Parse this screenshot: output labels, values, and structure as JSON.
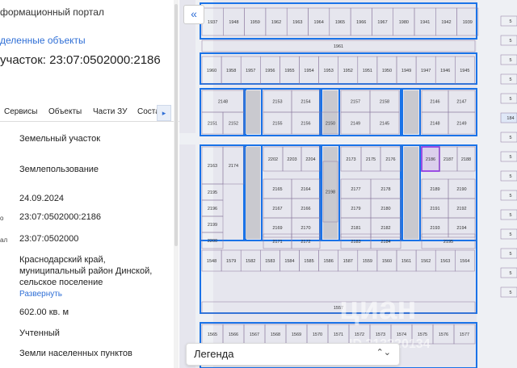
{
  "panel": {
    "portal_title": "формационный портал",
    "selected_link": "деленные объекты",
    "plot_title": "участок: 23:07:0502000:2186",
    "tabs": [
      "Сервисы",
      "Объекты",
      "Части ЗУ",
      "Соста"
    ],
    "tab_more_icon": "chevron-right-icon",
    "rows": [
      {
        "label": "",
        "value": "Земельный участок"
      },
      {
        "label": "",
        "value": "Землепользование"
      },
      {
        "label": "",
        "value": "24.09.2024"
      },
      {
        "label": "о",
        "value": "23:07:0502000:2186"
      },
      {
        "label": "ал",
        "value": "23:07:0502000"
      },
      {
        "label": "",
        "value_lines": [
          "Краснодарский край,",
          "муниципальный район Динской,",
          "сельское поселение"
        ],
        "expand_link": "Развернуть"
      },
      {
        "label": "",
        "value": "602.00 кв. м"
      },
      {
        "label": "",
        "value": "Учтенный"
      },
      {
        "label": "",
        "value": "Земли населенных пунктов"
      }
    ]
  },
  "map": {
    "back_icon": "double-chevron-left-icon",
    "legend_label": "Легенда",
    "legend_arrow_icon": "chevron-updown-icon",
    "watermark": "циан",
    "watermark_id": "ID 313320134",
    "highlight_color": "#8a2be2",
    "boundary_color": "#1a73e8",
    "plots": [
      {
        "n": "1937"
      },
      {
        "n": "1948"
      },
      {
        "n": "1959"
      },
      {
        "n": "1962"
      },
      {
        "n": "1963"
      },
      {
        "n": "1964"
      },
      {
        "n": "1965"
      },
      {
        "n": "1966"
      },
      {
        "n": "1967"
      },
      {
        "n": "1980"
      },
      {
        "n": "1941"
      },
      {
        "n": "1942"
      },
      {
        "n": "1939"
      },
      {
        "n": "1961"
      },
      {
        "n": "1960"
      },
      {
        "n": "1958"
      },
      {
        "n": "1957"
      },
      {
        "n": "1956"
      },
      {
        "n": "1955"
      },
      {
        "n": "1954"
      },
      {
        "n": "1953"
      },
      {
        "n": "1952"
      },
      {
        "n": "1951"
      },
      {
        "n": "1950"
      },
      {
        "n": "1949"
      },
      {
        "n": "1947"
      },
      {
        "n": "1946"
      },
      {
        "n": "1945"
      },
      {
        "n": "2148"
      },
      {
        "n": "2153"
      },
      {
        "n": "2154"
      },
      {
        "n": "2157"
      },
      {
        "n": "2158"
      },
      {
        "n": "2146"
      },
      {
        "n": "2147"
      },
      {
        "n": "2151"
      },
      {
        "n": "2152"
      },
      {
        "n": "2155"
      },
      {
        "n": "2156"
      },
      {
        "n": "2150"
      },
      {
        "n": "2149"
      },
      {
        "n": "2145"
      },
      {
        "n": "2148"
      },
      {
        "n": "2149"
      },
      {
        "n": "2163"
      },
      {
        "n": "2174"
      },
      {
        "n": "2202"
      },
      {
        "n": "2203"
      },
      {
        "n": "2204"
      },
      {
        "n": "2173"
      },
      {
        "n": "2175"
      },
      {
        "n": "2176"
      },
      {
        "n": "2186",
        "highlight": true
      },
      {
        "n": "2187"
      },
      {
        "n": "2188"
      },
      {
        "n": "2195"
      },
      {
        "n": "2165"
      },
      {
        "n": "2164"
      },
      {
        "n": "2198"
      },
      {
        "n": "2177"
      },
      {
        "n": "2178"
      },
      {
        "n": "2189"
      },
      {
        "n": "2190"
      },
      {
        "n": "2196"
      },
      {
        "n": "2167"
      },
      {
        "n": "2166"
      },
      {
        "n": "2179"
      },
      {
        "n": "2180"
      },
      {
        "n": "2191"
      },
      {
        "n": "2192"
      },
      {
        "n": "2199"
      },
      {
        "n": "2169"
      },
      {
        "n": "2170"
      },
      {
        "n": "2181"
      },
      {
        "n": "2182"
      },
      {
        "n": "2193"
      },
      {
        "n": "2194"
      },
      {
        "n": "2200"
      },
      {
        "n": "2171"
      },
      {
        "n": "2172"
      },
      {
        "n": "2183"
      },
      {
        "n": "2184"
      },
      {
        "n": "2195"
      },
      {
        "n": "1548"
      },
      {
        "n": "1579"
      },
      {
        "n": "1582"
      },
      {
        "n": "1583"
      },
      {
        "n": "1584"
      },
      {
        "n": "1585"
      },
      {
        "n": "1586"
      },
      {
        "n": "1587"
      },
      {
        "n": "1559"
      },
      {
        "n": "1560"
      },
      {
        "n": "1561"
      },
      {
        "n": "1562"
      },
      {
        "n": "1563"
      },
      {
        "n": "1564"
      },
      {
        "n": "1557"
      },
      {
        "n": "1565"
      },
      {
        "n": "1566"
      },
      {
        "n": "1567"
      },
      {
        "n": "1568"
      },
      {
        "n": "1569"
      },
      {
        "n": "1570"
      },
      {
        "n": "1571"
      },
      {
        "n": "1572"
      },
      {
        "n": "1573"
      },
      {
        "n": "1574"
      },
      {
        "n": "1575"
      },
      {
        "n": "1576"
      },
      {
        "n": "1577"
      }
    ],
    "edge_labels": [
      "5",
      "5",
      "5",
      "5",
      "5",
      "184",
      "5",
      "5",
      "5",
      "5",
      "5",
      "5",
      "5",
      "5",
      "5"
    ]
  }
}
